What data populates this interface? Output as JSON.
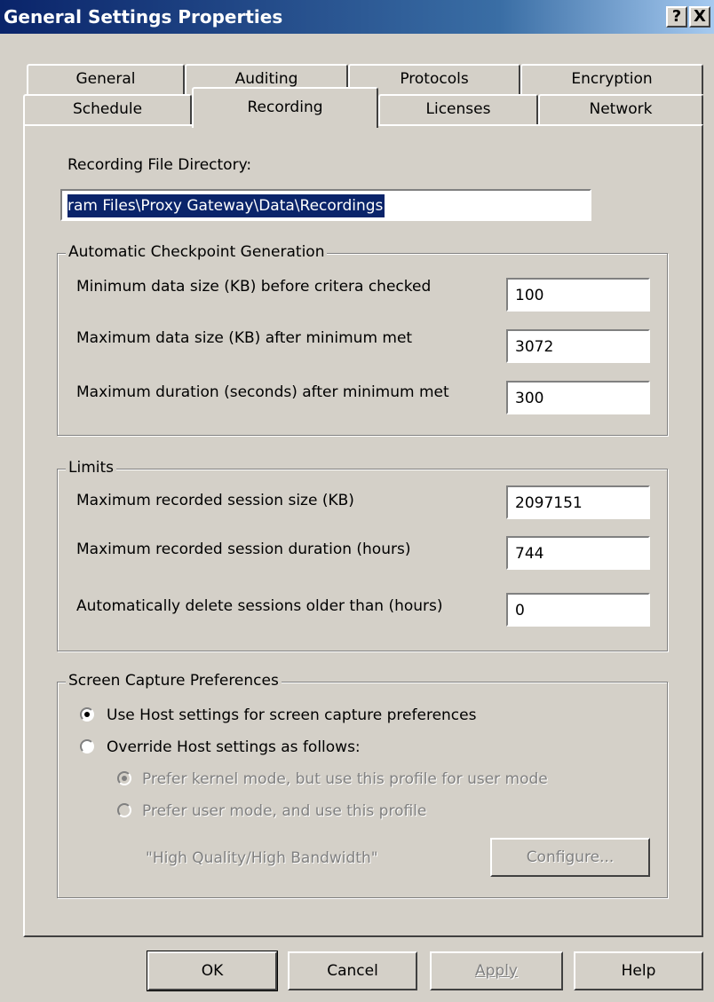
{
  "window": {
    "title": "General Settings Properties",
    "help_btn": "?",
    "close_btn": "X"
  },
  "tabs": {
    "row_top": [
      "General",
      "Auditing",
      "Protocols",
      "Encryption"
    ],
    "row_bottom": [
      "Schedule",
      "Recording",
      "Licenses",
      "Network"
    ],
    "active": "Recording"
  },
  "recording": {
    "dir_label": "Recording File Directory:",
    "dir_value": "ram Files\\Proxy Gateway\\Data\\Recordings"
  },
  "checkpoint": {
    "title": "Automatic Checkpoint Generation",
    "min_size_label": "Minimum data size (KB) before critera checked",
    "min_size_value": "100",
    "max_size_label": "Maximum data size (KB) after minimum met",
    "max_size_value": "3072",
    "max_duration_label": "Maximum duration (seconds) after minimum met",
    "max_duration_value": "300"
  },
  "limits": {
    "title": "Limits",
    "session_size_label": "Maximum recorded session size (KB)",
    "session_size_value": "2097151",
    "session_duration_label": "Maximum recorded session duration (hours)",
    "session_duration_value": "744",
    "auto_delete_label": "Automatically delete sessions older than (hours)",
    "auto_delete_value": "0"
  },
  "capture": {
    "title": "Screen Capture Preferences",
    "use_host_label": "Use Host settings for screen capture preferences",
    "override_label": "Override Host settings as follows:",
    "prefer_kernel_label": "Prefer kernel mode, but use this profile for user mode",
    "prefer_user_label": "Prefer user mode, and use this profile",
    "profile_text": "\"High Quality/High Bandwidth\"",
    "configure_label": "Configure..."
  },
  "buttons": {
    "ok": "OK",
    "cancel": "Cancel",
    "apply": "Apply",
    "help": "Help"
  },
  "colors": {
    "titlebar_start": "#0a246a",
    "titlebar_end": "#a6caf0",
    "dialog_bg": "#d4d0c8",
    "selection": "#0a246a"
  }
}
